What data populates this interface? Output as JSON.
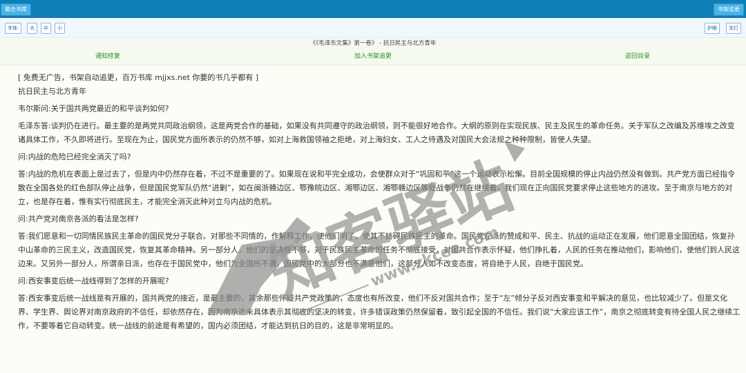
{
  "topbar": {
    "home_label": "聚合书库",
    "shelf_label": "书架追更"
  },
  "toolbar": {
    "font_label": "字体:",
    "large": "大",
    "medium": "中",
    "small": "小",
    "eye_care": "护眼",
    "lights_off": "关灯"
  },
  "breadcrumb": "《《毛泽东文集》第一卷》 - 抗日民主与北方青年",
  "nav": {
    "report": "通知修复",
    "add_shelf": "加入书架追更",
    "back": "返回目录"
  },
  "content": {
    "ad": "[ 免费无广告，书架自动追更，百万书库 mjjxs.net 你要的书几乎都有 ]",
    "chapter_title": "抗日民主与北方青年",
    "paragraphs": [
      "韦尔斯问:关于国共两党最近的和平谈判如何?",
      "毛泽东答:谈判仍在进行。最主要的是两党共同政治纲领，这是两党合作的基础，如果没有共同遵守的政治纲领，则不能很好地合作。大纲的原则在实现民族、民主及民生的革命任务。关于军队之改编及苏维埃之改变诸具体工作，不久即将进行。至现在为止，国民党方面所表示的仍然不够，如对上海救国领袖之拒绝，对上海妇女、工人之待遇及对国民大会法规之种种限制，皆使人失望。",
      "问:内战的危险已经完全消灭了吗?",
      "答:内战的危机在表面上是过去了，但是内中仍然存在着，不过不是重要的了。如果现在说和平完全成功，会使群众对于“巩固和平”这一个运动表示松懈。目前全国规模的停止内战仍然没有做到。共产党方面已经指令散在全国各处的红色部队停止战争，但是国民党军队仍然“进剿”，如在闽浙赣边区、鄂豫皖边区、湘鄂边区、湘鄂赣边区等处战争仍然在继续着，我们现在正向国民党要求停止这些地方的进攻。至于南京与地方的对立，也是存在着，惟有实行彻底民主，才能完全消灭此种对立与内战的危机。",
      "问:共产党对南京各派的看法是怎样?",
      "答:我们愿意和一切同情民族民主革命的国民党分子联合。对那些不同情的，作解释工作，使他们明了，使其不妨碍民族民主的革命。国民党左派的赞成和平、民主、抗战的运动正在发展，他们愿意全国团结，恢复孙中山革命的三民主义，改造国民党，恢复其革命精神。另一部分人，他们的坚决性不够，对于民族民主革命的任务不彻底接受，对国共合作表示怀疑，他们挣扎着，人民的任务在推动他们，影响他们，使他们到人民这边来。又另外一部分人，所谓亲日派，也存在于国民党中，他们为全国所不满，国民党中的大部分也不满意他们，这部分人如不改变态度，将自绝于人民，自绝于国民党。",
      "问:西安事变后统一战线得到了怎样的开展呢?",
      "答:西安事变后统一战线是有开展的，国共两党的接近，是最主要的，其余那些怀疑共产党政策的，态度也有所改变，他们不反对国共合作；至于“左”倾分子反对西安事变和平解决的意见，也比较减少了。但是文化界、学生界、舆论界对南京政府的不信任，却依然存在，因为南京迄未具体表示其彻底的坚决的转变，许多错误政策仍然保留着，致引起全国的不信任。我们说“大家应该工作”，南京之彻底转变有待全国人民之继续工作，不要等着它自动转变。统一战线的前途是有希望的，国内必须团结，才能达到抗日的目的，这是非常明显的。"
    ]
  },
  "watermark": {
    "brand": "知客驿站",
    "url": "www.zkcee.com",
    "color": "#8c8c8c"
  },
  "colors": {
    "topbar": "#0f7fb8",
    "button": "#4ab2e6",
    "nav_link": "#2f8a2f"
  }
}
